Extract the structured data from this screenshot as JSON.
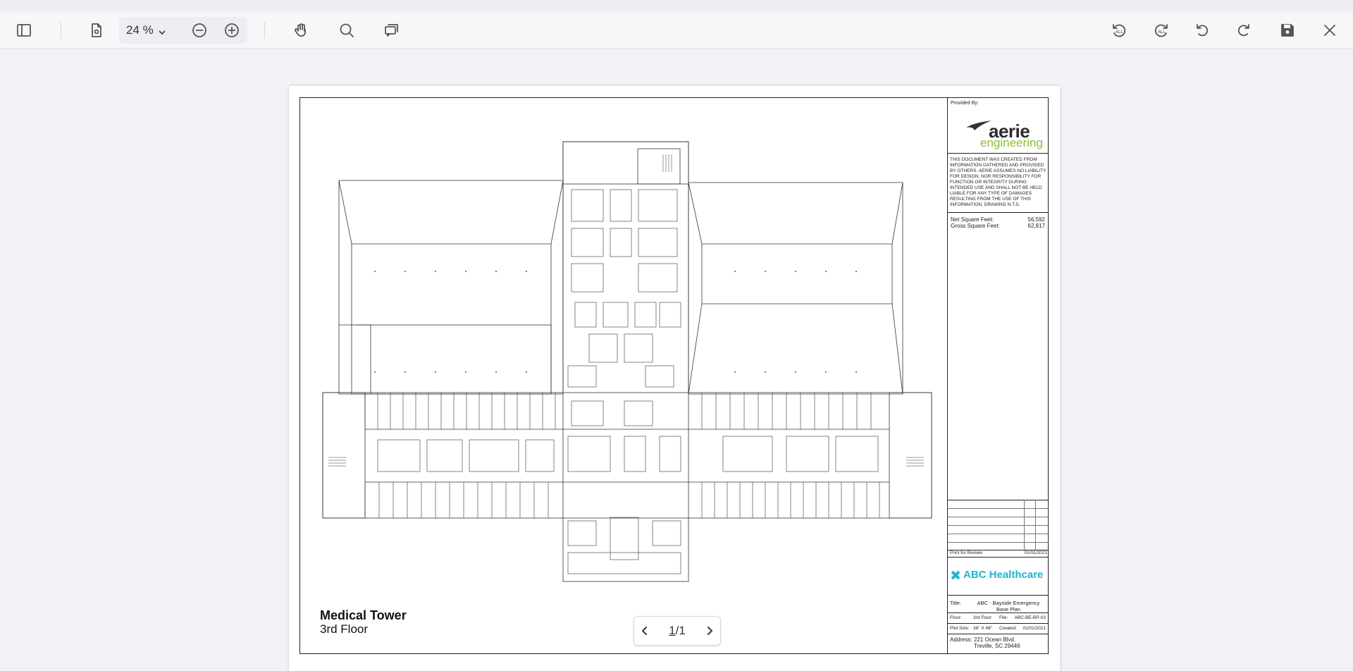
{
  "toolbar": {
    "zoom_value": "24 %",
    "icons": [
      "sidebar-toggle-icon",
      "page-settings-icon",
      "zoom-out-icon",
      "zoom-in-icon",
      "hand-tool-icon",
      "search-icon",
      "comment-icon",
      "rotate-all-ccw-icon",
      "rotate-all-cw-icon",
      "rotate-ccw-icon",
      "rotate-cw-icon",
      "save-icon",
      "close-icon"
    ],
    "rotate_all_label": "ALL"
  },
  "document": {
    "plan_title": "Medical Tower",
    "plan_subtitle": "3rd Floor",
    "title_block": {
      "provided_by": "Provided By:",
      "logo_main": "aerie",
      "logo_sub": "engineering",
      "disclaimer": "THIS DOCUMENT WAS CREATED FROM INFORMATION GATHERED AND PROVIDED BY OTHERS. AERIE ASSUMES NO LIABILITY FOR DESIGN, NOR RESPONSIBILITY FOR FUNCTION OR INTEGRITY DURING INTENDED USE AND SHALL NOT BE HELD LIABLE FOR ANY TYPE OF DAMAGES RESULTING FROM THE USE OF THIS INFORMATION. DRAWING N.T.S.",
      "net_sqft_label": "Net Square Feet:",
      "net_sqft_value": "56,592",
      "gross_sqft_label": "Gross Square Feet:",
      "gross_sqft_value": "62,817",
      "review_label": "Print for Review",
      "review_date": "01/01/2021",
      "client_logo": "ABC Healthcare",
      "title_label": "Title:",
      "title_value_1": "ABC - Bayside Emergency",
      "title_value_2": "Base Plan",
      "floor_label": "Floor:",
      "floor_value": "3rd Floor",
      "file_label": "File:",
      "file_value": "ABC-BE-BP-03",
      "plotsize_label": "Plot Size:",
      "plotsize_value": "36\" X 48\"",
      "created_label": "Created:",
      "created_value": "01/01/2021",
      "address_label": "Address:",
      "address_line1": "221 Ocean Blvd.",
      "address_line2": "Treville, SC 29446"
    }
  },
  "pager": {
    "current": "1",
    "separator": "/",
    "total": "1"
  },
  "colors": {
    "toolbar_bg": "#f6f7f9",
    "viewer_bg": "#f1f2f5",
    "abc_accent": "#1fb4d2",
    "aerie_green": "#8dbb3a"
  }
}
